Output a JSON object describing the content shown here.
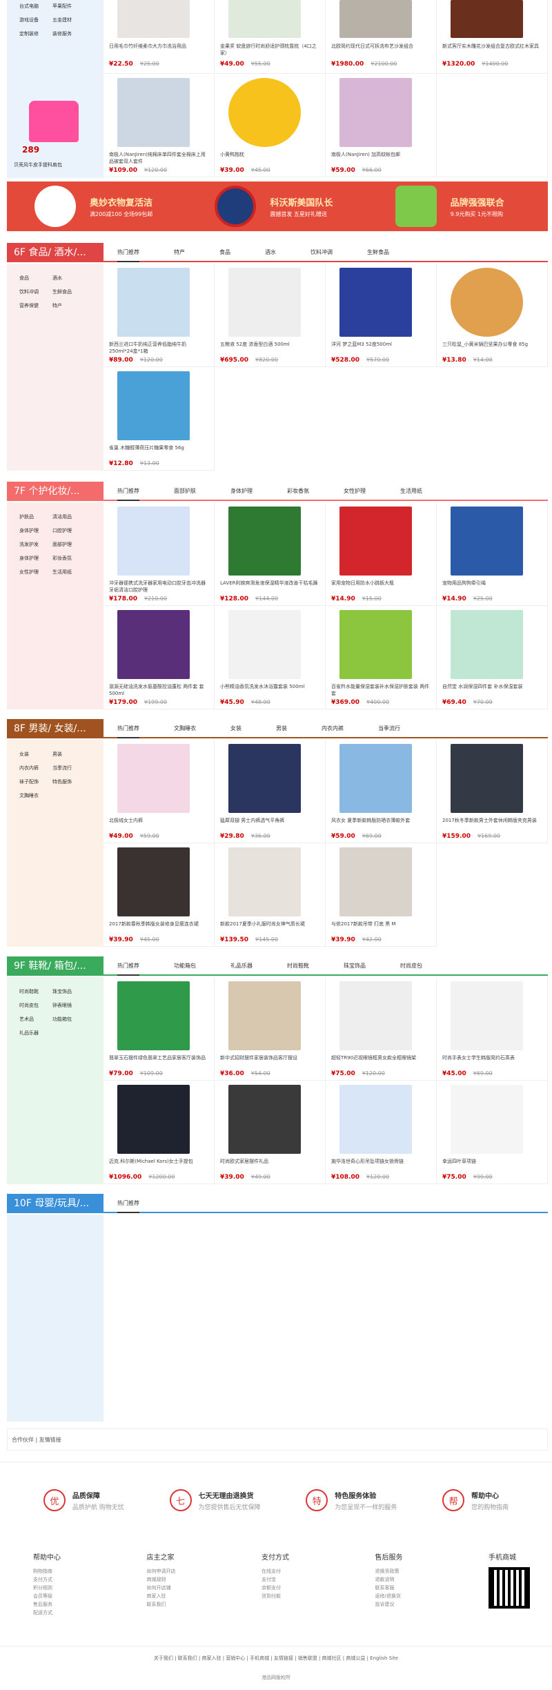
{
  "top_side": {
    "rows": [
      [
        "台式电脑",
        "苹果配件"
      ],
      [
        "游戏设备",
        "五金建材"
      ],
      [
        "定制装修",
        "装修服务"
      ]
    ],
    "ad_label": "贝壳风牛皮手提科肩包",
    "ad_price": "289"
  },
  "top_products": [
    {
      "name": "日用毛巾竹纤维柔巾大方巾洗浴用品",
      "price": "¥22.50",
      "old": "¥25.00"
    },
    {
      "name": "金果奖 软盘旅行时尚舒适护颈枕靠枕（4口之家）",
      "price": "¥49.00",
      "old": "¥55.00"
    },
    {
      "name": "北欧简约现代日式可拆洗布艺沙发组合",
      "price": "¥1980.00",
      "old": "¥2100.00"
    },
    {
      "name": "新式客厅实木雕花沙发组合复古欧式红木家具",
      "price": "¥1320.00",
      "old": "¥1400.00"
    },
    {
      "name": "南极人(NanJiren)纯棉床单四件套全棉床上用品被套双人套件",
      "price": "¥109.00",
      "old": "¥120.00"
    },
    {
      "name": "小黄鸭抱枕",
      "price": "¥39.00",
      "old": "¥45.00"
    },
    {
      "name": "南极人(NanJiren) 加高蚊帐包邮",
      "price": "¥59.00",
      "old": "¥66.00"
    }
  ],
  "banner": [
    {
      "title": "奥妙衣物复活洁",
      "sub": "满200减100 全场99包邮"
    },
    {
      "title": "科沃斯美国队长",
      "sub": "震撼首发 五星好礼赠送"
    },
    {
      "title": "品牌强强联合",
      "sub": "9.9元购买 1元不限购"
    }
  ],
  "floors": [
    {
      "title": "6F 食品/ 酒水/...",
      "tabs": [
        "热门推荐",
        "特产",
        "食品",
        "酒水",
        "饮料冲调",
        "生鲜食品"
      ],
      "side": [
        [
          "食品",
          "酒水"
        ],
        [
          "饮料冲调",
          "生鲜食品"
        ],
        [
          "营养保健",
          "特产"
        ]
      ],
      "products": [
        {
          "name": "新西兰进口牛奶纯正营养低脂纯牛奶250ml*24盒*1箱",
          "price": "¥89.00",
          "old": "¥120.00"
        },
        {
          "name": "五粮液 52度 浓香型白酒 500ml",
          "price": "¥695.00",
          "old": "¥820.00"
        },
        {
          "name": "洋河 梦之蓝M3 52度500ml",
          "price": "¥528.00",
          "old": "¥570.00"
        },
        {
          "name": "三只松鼠_小黄米锅巴坚果办公零食 85g",
          "price": "¥13.80",
          "old": "¥14.00"
        },
        {
          "name": "雀巢 木糖醇薄荷压片糖果零食 56g",
          "price": "¥12.80",
          "old": "¥13.00"
        }
      ]
    },
    {
      "title": "7F 个护化妆/...",
      "tabs": [
        "热门推荐",
        "面部护肤",
        "身体护理",
        "彩妆香氛",
        "女性护理",
        "生活用纸"
      ],
      "side": [
        [
          "护肤品",
          "清洁用品"
        ],
        [
          "身体护理",
          "口腔护理"
        ],
        [
          "洗发护发",
          "面部护理"
        ],
        [
          "身体护理",
          "彩妆香氛"
        ],
        [
          "女性护理",
          "生活用纸"
        ]
      ],
      "products": [
        {
          "name": "冲牙器便携式洗牙器家用电动口腔牙齿冲洗器牙垢清洁口腔护理",
          "price": "¥178.00",
          "old": "¥210.00"
        },
        {
          "name": "LAVER利婉爽滑发液保湿精华液改善干枯毛躁",
          "price": "¥128.00",
          "old": "¥144.00"
        },
        {
          "name": "家用宠物日用防水小跳板大瓶",
          "price": "¥14.90",
          "old": "¥15.00"
        },
        {
          "name": "宠物用品狗狗牵引绳",
          "price": "¥14.90",
          "old": "¥25.00"
        },
        {
          "name": "滋源无硅油洗发水氨基酸控油蓬松 两件套 套 500ml",
          "price": "¥179.00",
          "old": "¥199.00"
        },
        {
          "name": "小熊精油香氛洗发水沐浴露套装 500ml",
          "price": "¥45.90",
          "old": "¥48.00"
        },
        {
          "name": "百雀羚水能量保湿套装补水保湿护肤套装 两件套",
          "price": "¥369.00",
          "old": "¥400.00"
        },
        {
          "name": "自然堂 水润保湿四件套 补水保湿套装",
          "price": "¥69.40",
          "old": "¥70.00"
        }
      ]
    },
    {
      "title": "8F 男装/ 女装/...",
      "tabs": [
        "热门推荐",
        "文胸睡衣",
        "女装",
        "男装",
        "内衣内裤",
        "当季流行"
      ],
      "side": [
        [
          "女装",
          "男装"
        ],
        [
          "内衣内裤",
          "当季流行"
        ],
        [
          "袜子配饰",
          "特色服饰"
        ],
        [
          "文胸睡衣",
          ""
        ]
      ],
      "products": [
        {
          "name": "北极绒女士内裤",
          "price": "¥49.00",
          "old": "¥59.00"
        },
        {
          "name": "猛犀双翅 男士内裤透气平角裤",
          "price": "¥29.80",
          "old": "¥36.00"
        },
        {
          "name": "风衣女 夏季新款韩版防晒衣薄款外套",
          "price": "¥59.00",
          "old": "¥69.00"
        },
        {
          "name": "2017秋冬季新款男士外套休闲韩版夹克男装",
          "price": "¥159.00",
          "old": "¥169.00"
        },
        {
          "name": "2017新款春秋季韩版女装修身显瘦连衣裙",
          "price": "¥39.90",
          "old": "¥45.00"
        },
        {
          "name": "新款2017夏季小礼服时尚女神气质长裙",
          "price": "¥139.50",
          "old": "¥145.00"
        },
        {
          "name": "与依2017新款吊带 打底 黑 M",
          "price": "¥39.90",
          "old": "¥42.00"
        }
      ]
    },
    {
      "title": "9F 鞋靴/ 箱包/...",
      "tabs": [
        "热门推荐",
        "功能箱包",
        "礼品乐器",
        "时尚鞋靴",
        "珠宝饰品",
        "时尚皮包"
      ],
      "side": [
        [
          "时尚鞋靴",
          "珠宝饰品"
        ],
        [
          "时尚皮包",
          "钟表眼镜"
        ],
        [
          "艺术品",
          "功能箱包"
        ],
        [
          "礼品乐器",
          ""
        ]
      ],
      "products": [
        {
          "name": "翡翠玉石摆件绿色翡翠工艺品家居客厅装饰品",
          "price": "¥79.00",
          "old": "¥109.00"
        },
        {
          "name": "新中式招财摆件家居装饰品客厅摆设",
          "price": "¥36.00",
          "old": "¥54.00"
        },
        {
          "name": "超轻TR90近视眼镜框男女款全框眼镜架",
          "price": "¥75.00",
          "old": "¥120.00"
        },
        {
          "name": "时尚手表女士学生韩版简约石英表",
          "price": "¥45.00",
          "old": "¥69.00"
        },
        {
          "name": "迈克.科尔斯(Michael Kors)女士手提包",
          "price": "¥1096.00",
          "old": "¥1200.00"
        },
        {
          "name": "时尚欧式家居摆件礼品",
          "price": "¥39.00",
          "old": "¥49.00"
        },
        {
          "name": "施华洛世奇心形吊坠项链女锁骨链",
          "price": "¥108.00",
          "old": "¥120.00"
        },
        {
          "name": "幸运四叶草项链",
          "price": "¥75.00",
          "old": "¥99.00"
        }
      ]
    },
    {
      "title": "10F 母婴/玩具/...",
      "tabs": [
        "热门推荐"
      ],
      "side": [],
      "products": []
    }
  ],
  "partners_label": "合作伙伴 | 友情链接",
  "services": [
    {
      "icon": "优",
      "title": "品质保障",
      "sub": "品质护航 购物无忧"
    },
    {
      "icon": "七",
      "title": "七天无理由退换货",
      "sub": "为您提供售后无忧保障"
    },
    {
      "icon": "特",
      "title": "特色服务体验",
      "sub": "为您呈现不一样的服务"
    },
    {
      "icon": "帮",
      "title": "帮助中心",
      "sub": "您的购物指南"
    }
  ],
  "footer_cols": [
    {
      "title": "帮助中心",
      "items": [
        "购物指南",
        "支付方式",
        "积分规则",
        "会员等级",
        "售后服务",
        "配送方式"
      ]
    },
    {
      "title": "店主之家",
      "items": [
        "如何申请开店",
        "商城规则",
        "如何开店铺",
        "商家入驻",
        "联系我们"
      ]
    },
    {
      "title": "支付方式",
      "items": [
        "在线支付",
        "支付宝",
        "余额支付",
        "货到付款"
      ]
    },
    {
      "title": "售后服务",
      "items": [
        "退换货政策",
        "退款说明",
        "联系客服",
        "返修/退换货",
        "投诉建议"
      ]
    },
    {
      "title": "手机商城",
      "items": []
    }
  ],
  "footer_links": [
    "关于我们",
    "联系我们",
    "商家入驻",
    "营销中心",
    "手机商城",
    "友情链接",
    "销售联盟",
    "商城社区",
    "商城公益",
    "English Site"
  ],
  "copyright": "港品网版权所"
}
